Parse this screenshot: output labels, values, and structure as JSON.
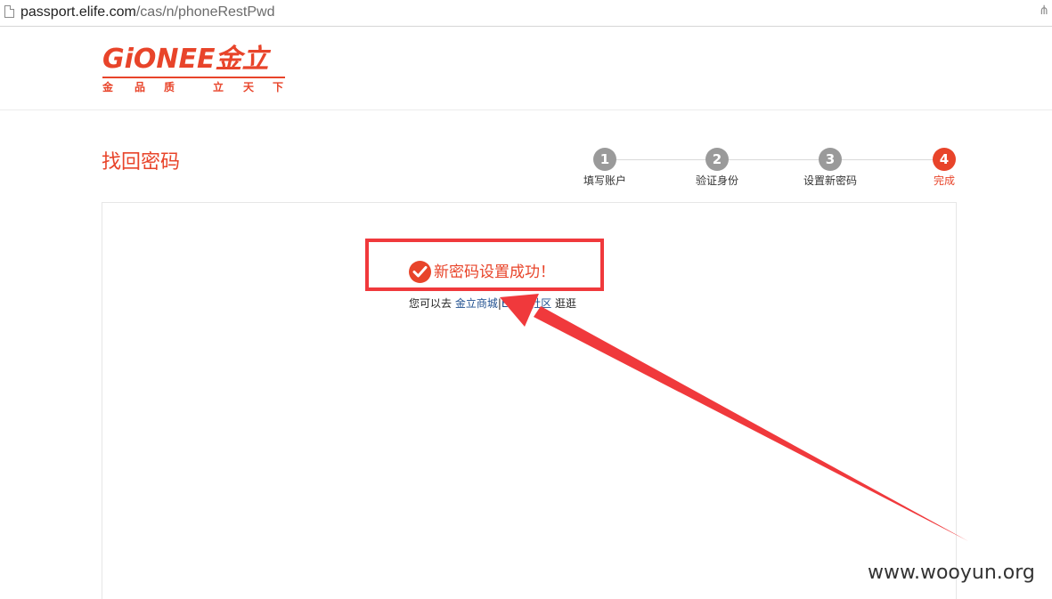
{
  "address_bar": {
    "url_host": "passport.elife.com",
    "url_path": "/cas/n/phoneRestPwd",
    "right_icon": "extension-icon"
  },
  "logo": {
    "main_text": "GiONEE金立",
    "slogan_chars": [
      "金",
      "品",
      "质",
      "立",
      "天",
      "下"
    ]
  },
  "page": {
    "title": "找回密码"
  },
  "steps": [
    {
      "number": "1",
      "label": "填写账户",
      "active": false
    },
    {
      "number": "2",
      "label": "验证身份",
      "active": false
    },
    {
      "number": "3",
      "label": "设置新密码",
      "active": false
    },
    {
      "number": "4",
      "label": "完成",
      "active": true
    }
  ],
  "success": {
    "icon": "check-circle-icon",
    "message": "新密码设置成功！",
    "prefix": "您可以去",
    "link_mall": "金立商城",
    "link_sep": "|",
    "link_community": "ELIFE社区",
    "suffix": "逛逛"
  },
  "watermark": "www.wooyun.org",
  "colors": {
    "brand": "#e8442a",
    "step_inactive": "#9a9a9a",
    "annotation": "#f0393c",
    "link": "#1f4f8f"
  }
}
